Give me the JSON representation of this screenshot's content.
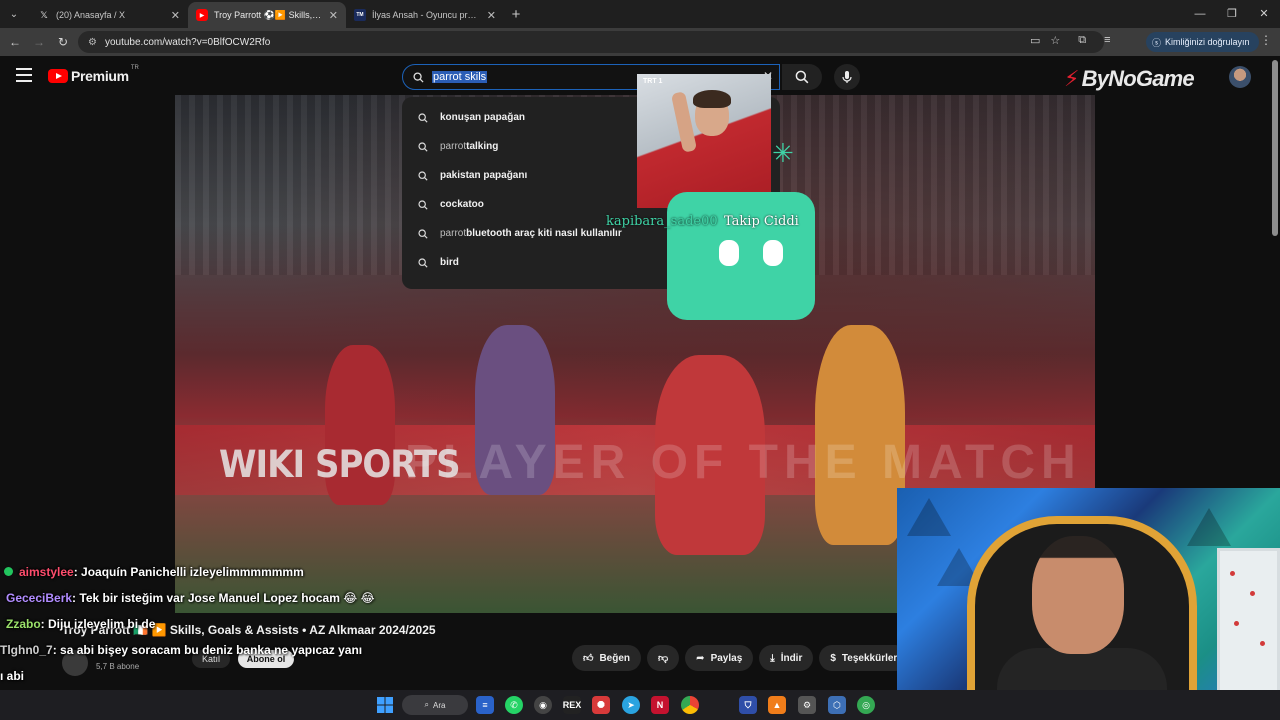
{
  "browser": {
    "tabs": [
      {
        "title": "(20) Anasayfa / X",
        "favicon": "x-logo-icon",
        "active": false
      },
      {
        "title": "Troy Parrott ⚽▶️ Skills, Goals & Assists",
        "favicon": "youtube-icon",
        "active": true
      },
      {
        "title": "İlyas Ansah - Oyuncu profili 25",
        "favicon": "transfermarkt-icon",
        "active": false
      }
    ],
    "url": "youtube.com/watch?v=0BlfOCW2Rfo",
    "profile_pill": "Kimliğinizi doğrulayın"
  },
  "youtube": {
    "logo_text": "Premium",
    "logo_region": "TR",
    "search_query": "parrot skils",
    "suggestions": [
      {
        "prefix": "",
        "bold": "konuşan papağan"
      },
      {
        "prefix": "parrot ",
        "bold": "talking"
      },
      {
        "prefix": "",
        "bold": "pakistan papağanı"
      },
      {
        "prefix": "",
        "bold": "cockatoo"
      },
      {
        "prefix": "parrot ",
        "bold": "bluetooth araç kiti nasıl kullanılır"
      },
      {
        "prefix": "",
        "bold": "bird"
      }
    ],
    "sponsor_logo": "ByNoGame"
  },
  "video": {
    "watermark": "WIKI SPORTS",
    "background_text": "PLAYER OF THE MATCH",
    "photo_badge": "TRT 1",
    "title": "Troy Parrott 🇮🇪 ▶️ Skills, Goals & Assists • AZ Alkmaar 2024/2025",
    "subscribers": "5,7 B abone",
    "join_label": "Katıl",
    "subscribe_label": "Abone ol",
    "actions": {
      "like": "Beğen",
      "share": "Paylaş",
      "download": "İndir",
      "thanks": "Teşekkürler"
    }
  },
  "follow_alert": {
    "username": "kapibara_sade00",
    "action": "Takip Ciddi"
  },
  "chat": [
    {
      "user": "aimstylee",
      "text": ": Joaquín Panichelli izleyelimmmmmmm",
      "color": "#ff4d6d"
    },
    {
      "user": "GececiBerk",
      "text": ": Tek bir isteğim var Jose Manuel Lopez hocam 😂 😂",
      "color": "#b18cff"
    },
    {
      "user": "Zzabo",
      "text": ": Diju izleyelim bi de",
      "color": "#9be16a"
    },
    {
      "user": "Tlghn0_7",
      "text": ": sa abi bişey soracam bu deniz banka ne yapıcaz yanı",
      "color": "#cfcfcf"
    },
    {
      "user": "",
      "text": "ı abi",
      "color": "#ffffff"
    }
  ],
  "taskbar": {
    "search_label": "Ara"
  },
  "colors": {
    "accent_red": "#ff0000",
    "alert_green": "#3fd3a6",
    "search_border": "#1c62b9"
  }
}
